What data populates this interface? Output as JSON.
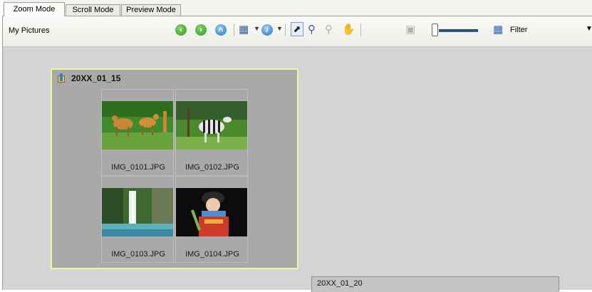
{
  "tabs": [
    {
      "label": "Zoom Mode",
      "active": true
    },
    {
      "label": "Scroll Mode",
      "active": false
    },
    {
      "label": "Preview Mode",
      "active": false
    }
  ],
  "toolbar": {
    "location": "My Pictures",
    "back_icon": "back-arrow-icon",
    "forward_icon": "forward-arrow-icon",
    "up_icon": "up-arrow-icon",
    "filter_label": "Filter",
    "zoom_slider_level": 0.05
  },
  "groups": [
    {
      "title": "20XX_01_15",
      "items": [
        {
          "filename": "IMG_0101.JPG",
          "subject": "antelopes"
        },
        {
          "filename": "IMG_0102.JPG",
          "subject": "zebra"
        },
        {
          "filename": "IMG_0103.JPG",
          "subject": "waterfall"
        },
        {
          "filename": "IMG_0104.JPG",
          "subject": "child"
        }
      ]
    },
    {
      "title": "20XX_01_20",
      "items": []
    }
  ],
  "colors": {
    "group_border_selected": "#f3f3a6",
    "group_background": "#a9a9a9",
    "canvas_background": "#d4d4d4"
  }
}
